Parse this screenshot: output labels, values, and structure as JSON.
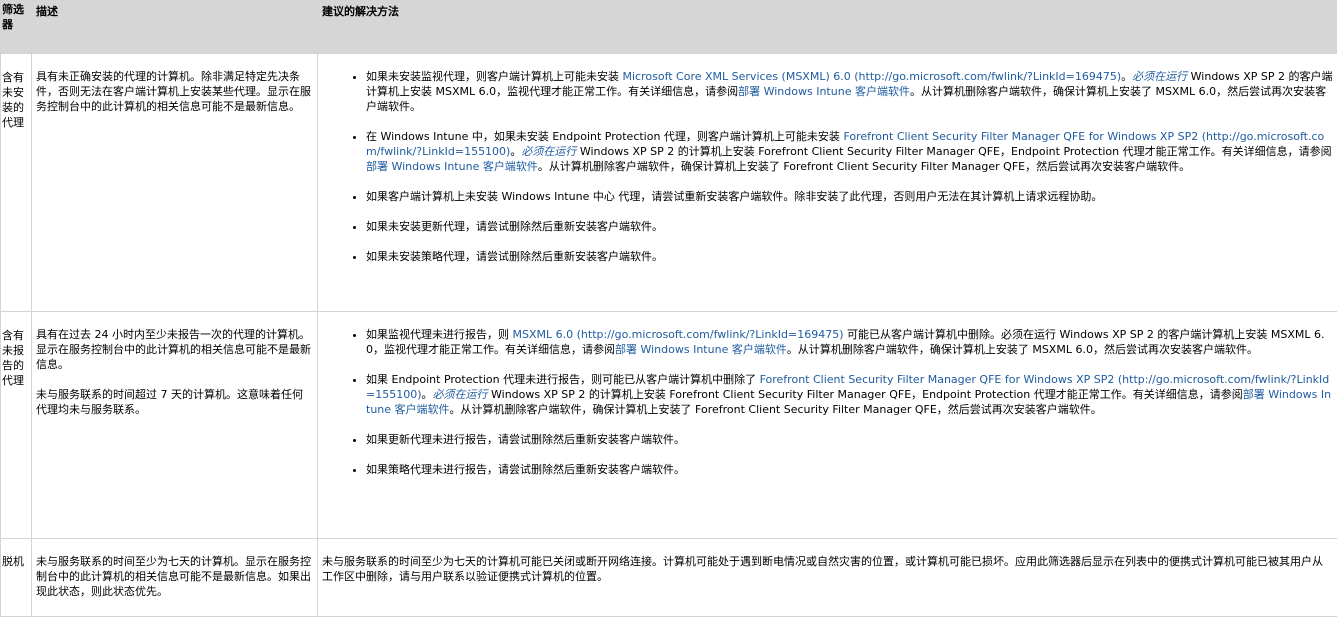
{
  "header": {
    "filter": "筛选器",
    "description": "描述",
    "solution": "建议的解决方法"
  },
  "row1": {
    "filter": "含有未安装的代理",
    "description": "具有未正确安装的代理的计算机。除非满足特定先决条件，否则无法在客户端计算机上安装某些代理。显示在服务控制台中的此计算机的相关信息可能不是最新信息。",
    "items": [
      {
        "t1": "如果未安装监视代理，则客户端计算机上可能未安装 ",
        "l1": "Microsoft Core XML Services (MSXML) 6.0 (http://go.microsoft.com/fwlink/?LinkId=169475)",
        "t2": "。",
        "l2": "必须在运行",
        "t3": " Windows XP SP 2 的客户端计算机上安装 MSXML 6.0，监视代理才能正常工作。有关详细信息，请参阅",
        "l3": "部署 Windows Intune 客户端软件",
        "t4": "。从计算机删除客户端软件，确保计算机上安装了 MSXML 6.0，然后尝试再次安装客户端软件。"
      },
      {
        "t1": "在 Windows Intune 中，如果未安装 Endpoint Protection 代理，则客户端计算机上可能未安装 ",
        "l1": "Forefront Client Security Filter Manager QFE for Windows XP SP2 (http://go.microsoft.com/fwlink/?LinkId=155100)",
        "t2": "。",
        "l2": "必须在运行",
        "t3": " Windows XP SP 2 的计算机上安装 Forefront Client Security Filter Manager QFE，Endpoint Protection 代理才能正常工作。有关详细信息，请参阅",
        "l3": "部署 Windows Intune 客户端软件",
        "t4": "。从计算机删除客户端软件，确保计算机上安装了 Forefront Client Security Filter Manager QFE，然后尝试再次安装客户端软件。"
      },
      {
        "text": "如果客户端计算机上未安装 Windows Intune 中心 代理，请尝试重新安装客户端软件。除非安装了此代理，否则用户无法在其计算机上请求远程协助。"
      },
      {
        "text": "如果未安装更新代理，请尝试删除然后重新安装客户端软件。"
      },
      {
        "text": "如果未安装策略代理，请尝试删除然后重新安装客户端软件。"
      }
    ]
  },
  "row2": {
    "filter": "含有未报告的代理",
    "description_p1": "具有在过去 24 小时内至少未报告一次的代理的计算机。显示在服务控制台中的此计算机的相关信息可能不是最新信息。",
    "description_p2": "未与服务联系的时间超过 7 天的计算机。这意味着任何代理均未与服务联系。",
    "items": [
      {
        "t1": "如果监视代理未进行报告，则 ",
        "l1": "MSXML 6.0 (http://go.microsoft.com/fwlink/?LinkId=169475)",
        "t2": " 可能已从客户端计算机中删除。必须在运行 Windows XP SP 2 的客户端计算机上安装 MSXML 6.0，监视代理才能正常工作。有关详细信息，请参阅",
        "l2": "部署 Windows Intune 客户端软件",
        "t3": "。从计算机删除客户端软件，确保计算机上安装了 MSXML 6.0，然后尝试再次安装客户端软件。"
      },
      {
        "t1": "如果 Endpoint Protection 代理未进行报告，则可能已从客户端计算机中删除了 ",
        "l1": "Forefront Client Security Filter Manager QFE for Windows XP SP2 (http://go.microsoft.com/fwlink/?LinkId=155100)",
        "t2": "。",
        "l2": "必须在运行",
        "t3": " Windows XP SP 2 的计算机上安装 Forefront Client Security Filter Manager QFE，Endpoint Protection 代理才能正常工作。有关详细信息，请参阅",
        "l3": "部署 Windows Intune 客户端软件",
        "t4": "。从计算机删除客户端软件，确保计算机上安装了 Forefront Client Security Filter Manager QFE，然后尝试再次安装客户端软件。"
      },
      {
        "text": "如果更新代理未进行报告，请尝试删除然后重新安装客户端软件。"
      },
      {
        "text": "如果策略代理未进行报告，请尝试删除然后重新安装客户端软件。"
      }
    ]
  },
  "row3": {
    "filter": "脱机",
    "description": "未与服务联系的时间至少为七天的计算机。显示在服务控制台中的此计算机的相关信息可能不是最新信息。如果出现此状态，则此状态优先。",
    "solution": "未与服务联系的时间至少为七天的计算机可能已关闭或断开网络连接。计算机可能处于遇到断电情况或自然灾害的位置，或计算机可能已损坏。应用此筛选器后显示在列表中的便携式计算机可能已被其用户从工作区中删除，请与用户联系以验证便携式计算机的位置。"
  },
  "colors": {
    "header_bg": "#d6d6d6",
    "link": "#1f5ca0",
    "border": "#d4d4d4"
  }
}
